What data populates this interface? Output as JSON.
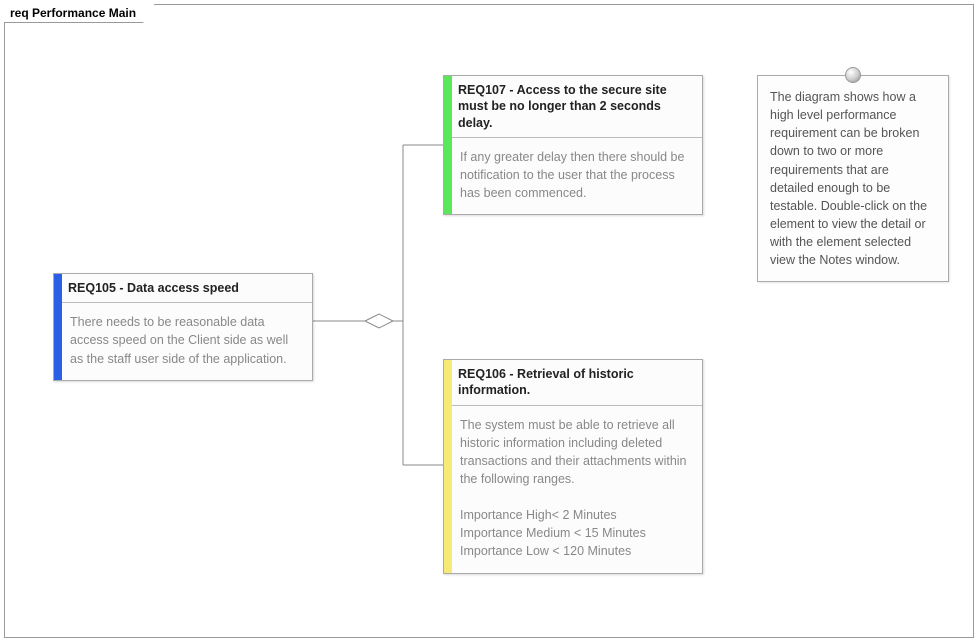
{
  "frame": {
    "label": "req Performance Main"
  },
  "req105": {
    "title": "REQ105 -  Data access speed",
    "body": "There needs to be reasonable data access speed on the Client side as well as the staff user side of the application.",
    "color": "#2a5fe6"
  },
  "req107": {
    "title": "REQ107 - Access to the secure site must be no longer than 2 seconds delay.",
    "body": "If any greater delay then there should be notification to the user that the process has been commenced.",
    "color": "#5ce65c"
  },
  "req106": {
    "title": "REQ106 - Retrieval of historic information.",
    "body": "The system must be able to retrieve all historic information including deleted transactions and their attachments within the following ranges.\n\nImportance High< 2 Minutes\nImportance Medium < 15 Minutes\nImportance Low < 120 Minutes",
    "color": "#f5e97a"
  },
  "note": {
    "text": "The diagram shows how a high level performance requirement can be broken down to two or more requirements that are detailed enough to be testable. Double-click on the element to view the detail or with the element selected view the Notes window."
  }
}
